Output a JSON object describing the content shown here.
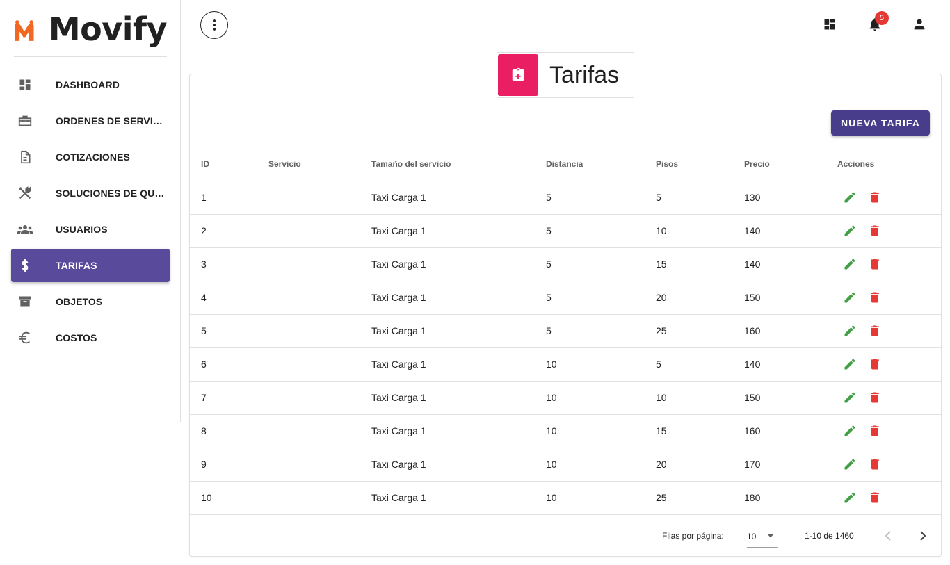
{
  "brand": {
    "name": "Movify",
    "logo_icon": "movify-m-logo",
    "accent": "#f26722"
  },
  "sidebar": {
    "items": [
      {
        "label": "DASHBOARD",
        "icon": "dashboard-icon"
      },
      {
        "label": "ORDENES DE SERVICIO",
        "icon": "toolbox-icon"
      },
      {
        "label": "COTIZACIONES",
        "icon": "document-icon"
      },
      {
        "label": "SOLUCIONES DE QUIE...",
        "icon": "tools-icon"
      },
      {
        "label": "USUARIOS",
        "icon": "group-icon"
      },
      {
        "label": "TARIFAS",
        "icon": "dollar-icon",
        "active": true
      },
      {
        "label": "OBJETOS",
        "icon": "archive-icon"
      },
      {
        "label": "COSTOS",
        "icon": "euro-icon"
      }
    ],
    "active_color": "#5a4a9c"
  },
  "topbar": {
    "notifications_count": "5"
  },
  "page": {
    "title": "Tarifas",
    "header_color": "#e91e63",
    "new_button_label": "NUEVA TARIFA",
    "button_color": "#483d8b"
  },
  "table": {
    "columns": [
      "ID",
      "Servicio",
      "Tamaño del servicio",
      "Distancia",
      "Pisos",
      "Precio",
      "Acciones"
    ],
    "rows": [
      {
        "id": "1",
        "servicio": "",
        "tamano": "Taxi Carga 1",
        "distancia": "5",
        "pisos": "5",
        "precio": "130"
      },
      {
        "id": "2",
        "servicio": "",
        "tamano": "Taxi Carga 1",
        "distancia": "5",
        "pisos": "10",
        "precio": "140"
      },
      {
        "id": "3",
        "servicio": "",
        "tamano": "Taxi Carga 1",
        "distancia": "5",
        "pisos": "15",
        "precio": "140"
      },
      {
        "id": "4",
        "servicio": "",
        "tamano": "Taxi Carga 1",
        "distancia": "5",
        "pisos": "20",
        "precio": "150"
      },
      {
        "id": "5",
        "servicio": "",
        "tamano": "Taxi Carga 1",
        "distancia": "5",
        "pisos": "25",
        "precio": "160"
      },
      {
        "id": "6",
        "servicio": "",
        "tamano": "Taxi Carga 1",
        "distancia": "10",
        "pisos": "5",
        "precio": "140"
      },
      {
        "id": "7",
        "servicio": "",
        "tamano": "Taxi Carga 1",
        "distancia": "10",
        "pisos": "10",
        "precio": "150"
      },
      {
        "id": "8",
        "servicio": "",
        "tamano": "Taxi Carga 1",
        "distancia": "10",
        "pisos": "15",
        "precio": "160"
      },
      {
        "id": "9",
        "servicio": "",
        "tamano": "Taxi Carga 1",
        "distancia": "10",
        "pisos": "20",
        "precio": "170"
      },
      {
        "id": "10",
        "servicio": "",
        "tamano": "Taxi Carga 1",
        "distancia": "10",
        "pisos": "25",
        "precio": "180"
      }
    ],
    "edit_color": "#43a047",
    "delete_color": "#e53935"
  },
  "pagination": {
    "rows_per_page_label": "Filas por página:",
    "rows_per_page": "10",
    "range": "1-10 de 1460"
  }
}
